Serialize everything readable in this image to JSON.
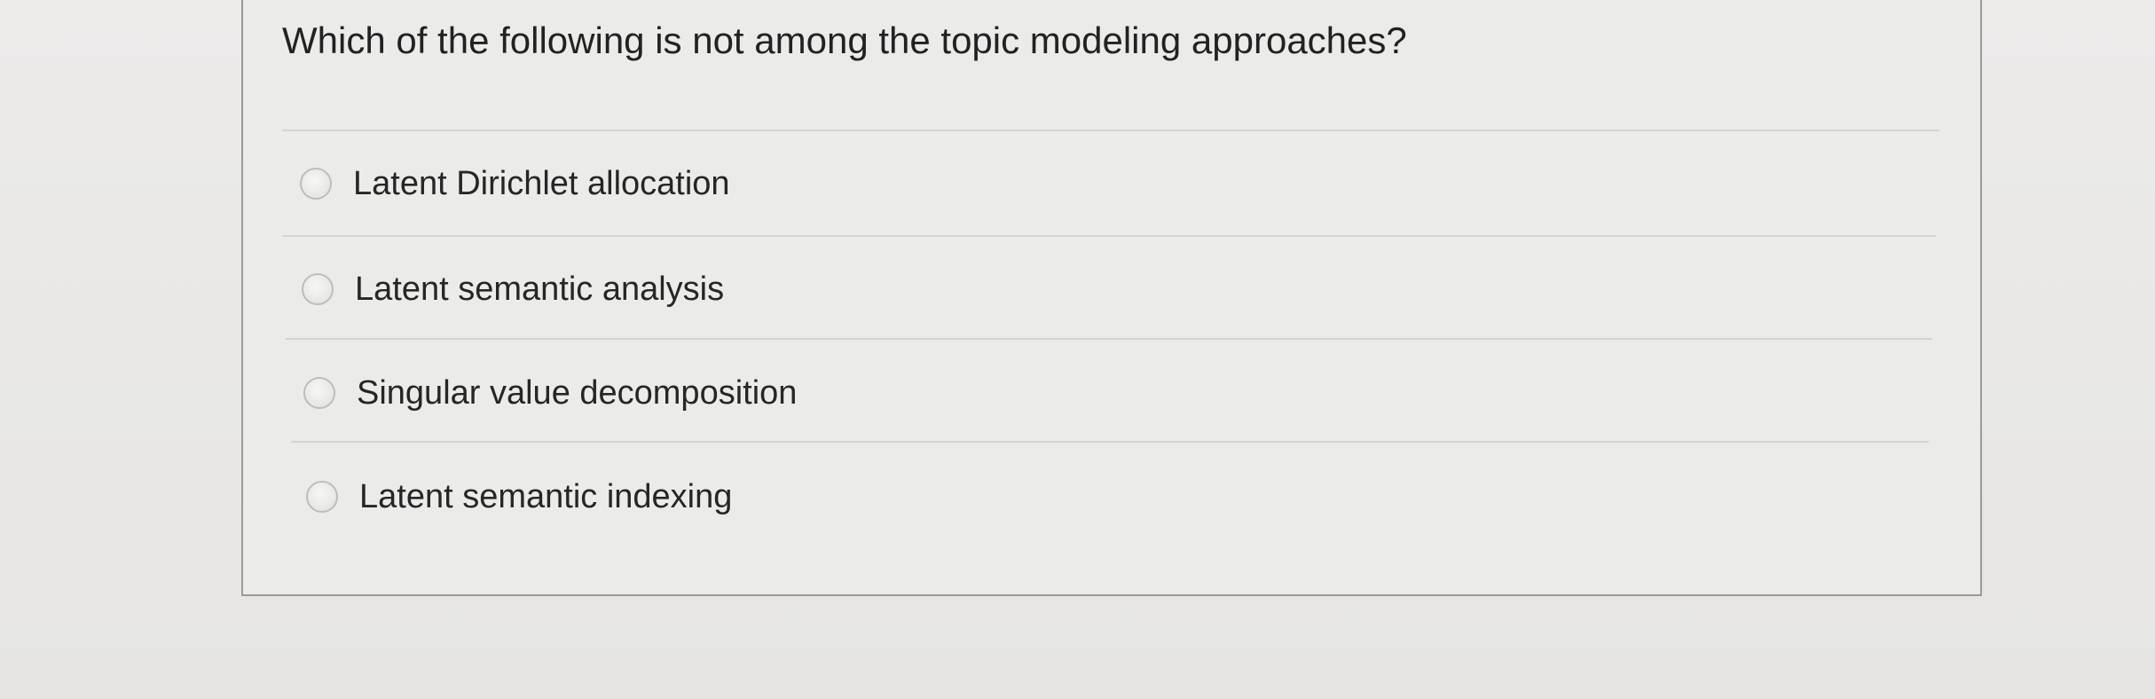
{
  "question": {
    "text": "Which of the following is not among the topic modeling approaches?"
  },
  "answers": [
    {
      "label": "Latent Dirichlet allocation",
      "selected": false
    },
    {
      "label": "Latent semantic analysis",
      "selected": false
    },
    {
      "label": "Singular value decomposition",
      "selected": false
    },
    {
      "label": "Latent semantic indexing",
      "selected": false
    }
  ]
}
